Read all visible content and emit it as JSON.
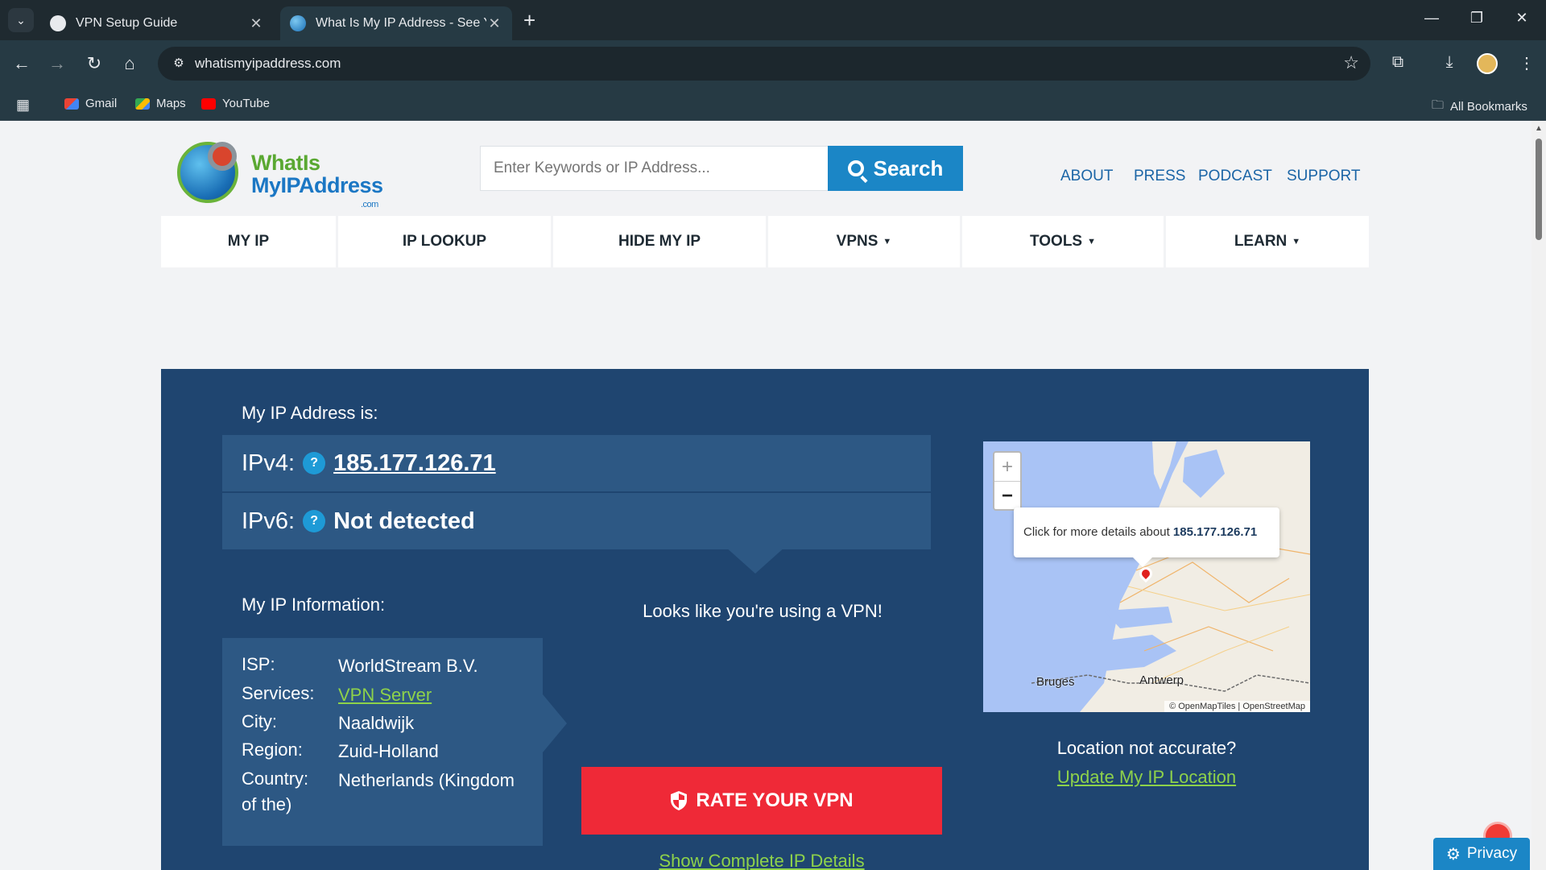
{
  "browser": {
    "tabs": [
      {
        "title": "VPN Setup Guide",
        "active": false
      },
      {
        "title": "What Is My IP Address - See Yo",
        "active": true
      }
    ],
    "url": "whatismyipaddress.com",
    "bookmarks": [
      {
        "label": "Gmail",
        "icon": "gmail-icon"
      },
      {
        "label": "Maps",
        "icon": "maps-icon"
      },
      {
        "label": "YouTube",
        "icon": "youtube-icon"
      }
    ],
    "all_bookmarks": "All Bookmarks",
    "colors": {
      "chrome_dark": "#1f2a30",
      "chrome_toolbar": "#263a44"
    }
  },
  "site": {
    "logo": {
      "line1": "WhatIs",
      "line2": "MyIPAddress",
      "line3": ".com"
    },
    "search": {
      "placeholder": "Enter Keywords or IP Address...",
      "button": "Search"
    },
    "top_links": [
      "ABOUT",
      "PRESS",
      "PODCAST",
      "SUPPORT"
    ],
    "main_nav": [
      {
        "label": "MY IP",
        "dropdown": false
      },
      {
        "label": "IP LOOKUP",
        "dropdown": false
      },
      {
        "label": "HIDE MY IP",
        "dropdown": false
      },
      {
        "label": "VPNS",
        "dropdown": true
      },
      {
        "label": "TOOLS",
        "dropdown": true
      },
      {
        "label": "LEARN",
        "dropdown": true
      }
    ],
    "colors": {
      "hero_bg": "#1f4570",
      "box_bg": "#2d5884",
      "accent_blue": "#1b86c6",
      "link_green": "#8ed24a",
      "cta_red": "#ef2937"
    }
  },
  "hero": {
    "ip_heading": "My IP Address is:",
    "ipv4_label": "IPv4:",
    "ipv4_value": "185.177.126.71",
    "ipv6_label": "IPv6:",
    "ipv6_value": "Not detected",
    "help_glyph": "?",
    "info_heading": "My IP Information:",
    "info": [
      {
        "key": "ISP:",
        "value": "WorldStream B.V.",
        "link": false
      },
      {
        "key": "Services:",
        "value": "VPN Server",
        "link": true
      },
      {
        "key": "City:",
        "value": "Naaldwijk",
        "link": false
      },
      {
        "key": "Region:",
        "value": "Zuid-Holland",
        "link": false
      },
      {
        "key": "Country:",
        "value": "Netherlands (Kingdom of the)",
        "link": false
      }
    ],
    "vpn_message": "Looks like you're using a VPN!",
    "rate_button": "RATE YOUR VPN",
    "show_details": "Show Complete IP Details",
    "location_question": "Location not accurate?",
    "update_location": "Update My IP Location"
  },
  "map": {
    "zoom_in": "+",
    "zoom_out": "−",
    "popup_text": "Click for more details about ",
    "popup_ip": "185.177.126.71",
    "cities": [
      "Bruges",
      "Antwerp"
    ],
    "attribution": "© OpenMapTiles | OpenStreetMap"
  },
  "privacy": {
    "label": "Privacy"
  }
}
